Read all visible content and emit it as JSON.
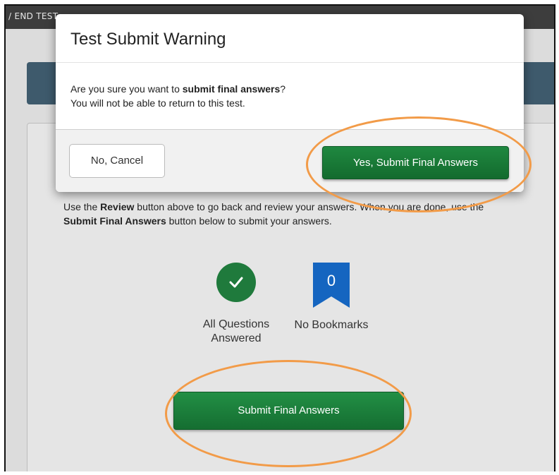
{
  "breadcrumb": {
    "text": "/  END TEST"
  },
  "instructions": {
    "part1": "Use the ",
    "review_word": "Review",
    "part2": " button above to go back and review your answers. When you are done, use the ",
    "submit_word": "Submit Final Answers",
    "part3": " button below to submit your answers."
  },
  "status": {
    "answered_label": "All Questions Answered",
    "bookmark_count": "0",
    "bookmarks_label": "No Bookmarks"
  },
  "submit_button_label": "Submit Final Answers",
  "modal": {
    "title": "Test Submit Warning",
    "line1_prefix": "Are you sure you want to ",
    "line1_bold": "submit final answers",
    "line1_suffix": "?",
    "line2": "You will not be able to return to this test.",
    "cancel_label": "No, Cancel",
    "confirm_label": "Yes, Submit Final Answers"
  },
  "colors": {
    "accent_green": "#1f7a3c",
    "bookmark_blue": "#1565c0",
    "highlight_orange": "#f29b48",
    "header_band": "#3e5a6c"
  }
}
